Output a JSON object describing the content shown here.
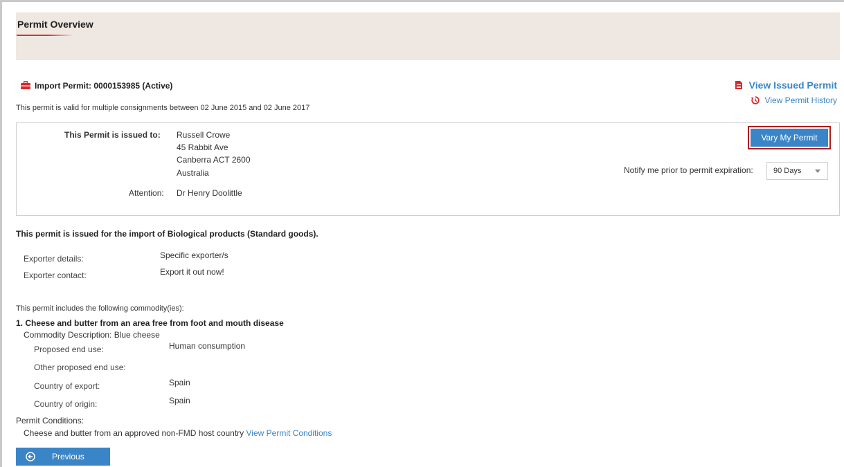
{
  "overview": {
    "title": "Permit Overview"
  },
  "permit": {
    "title": "Import Permit: 0000153985 (Active)",
    "validity": "This permit is valid for multiple consignments between 02 June 2015 and 02 June 2017",
    "view_issued_label": "View Issued Permit",
    "view_history_label": "View Permit History"
  },
  "issued_to": {
    "label": "This Permit is issued to:",
    "address_lines": [
      "Russell Crowe",
      "45 Rabbit Ave",
      "Canberra ACT 2600",
      "Australia"
    ],
    "attention_label": "Attention:",
    "attention_value": "Dr Henry Doolittle"
  },
  "actions": {
    "vary_label": "Vary My Permit",
    "notify_label": "Notify me prior to permit expiration:",
    "notify_selected": "90 Days"
  },
  "purpose": "This permit is issued for the import of Biological products (Standard goods).",
  "exporter": {
    "details_label": "Exporter details:",
    "details_value": "Specific exporter/s",
    "contact_label": "Exporter contact:",
    "contact_value": "Export it out now!"
  },
  "commodities_intro": "This permit includes the following commodity(ies):",
  "commodity": {
    "title": "1. Cheese and butter from an area free from foot and mouth disease",
    "description": "Commodity Description: Blue cheese",
    "fields": [
      {
        "label": "Proposed end use:",
        "value": "Human consumption"
      },
      {
        "label": "Other proposed end use:",
        "value": ""
      },
      {
        "label": "Country of export:",
        "value": "Spain"
      },
      {
        "label": "Country of origin:",
        "value": "Spain"
      }
    ]
  },
  "conditions": {
    "label": "Permit Conditions:",
    "text": "Cheese and butter from an approved non-FMD host country",
    "link_label": "View Permit Conditions"
  },
  "navigation": {
    "previous_label": "Previous"
  },
  "colors": {
    "accent": "#3a85c7",
    "highlight": "#b01c1c",
    "header_bg": "#efe7e1",
    "icon_red": "#d62b2b"
  }
}
